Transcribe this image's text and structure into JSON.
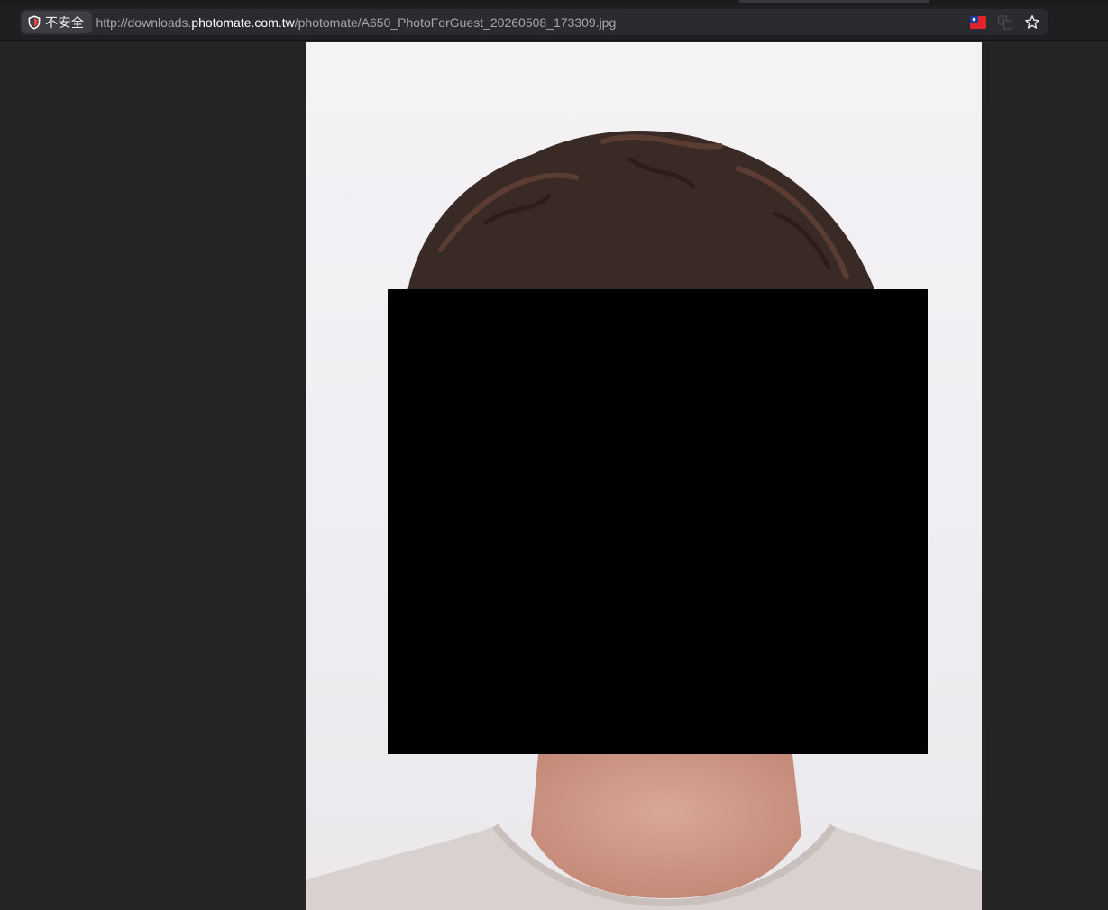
{
  "browser": {
    "security_label": "不安全",
    "url_prefix": "http://downloads.",
    "url_host": "photomate.com.tw",
    "url_path": "/photomate/A650_PhotoForGuest_20260508_173309.jpg",
    "icons": [
      "shield-warning-icon",
      "taiwan-flag-icon",
      "translate-icon",
      "bookmark-star-icon"
    ]
  },
  "viewer": {
    "image_name": "A650_PhotoForGuest_20260508_173309.jpg",
    "background_color": "#242424"
  }
}
